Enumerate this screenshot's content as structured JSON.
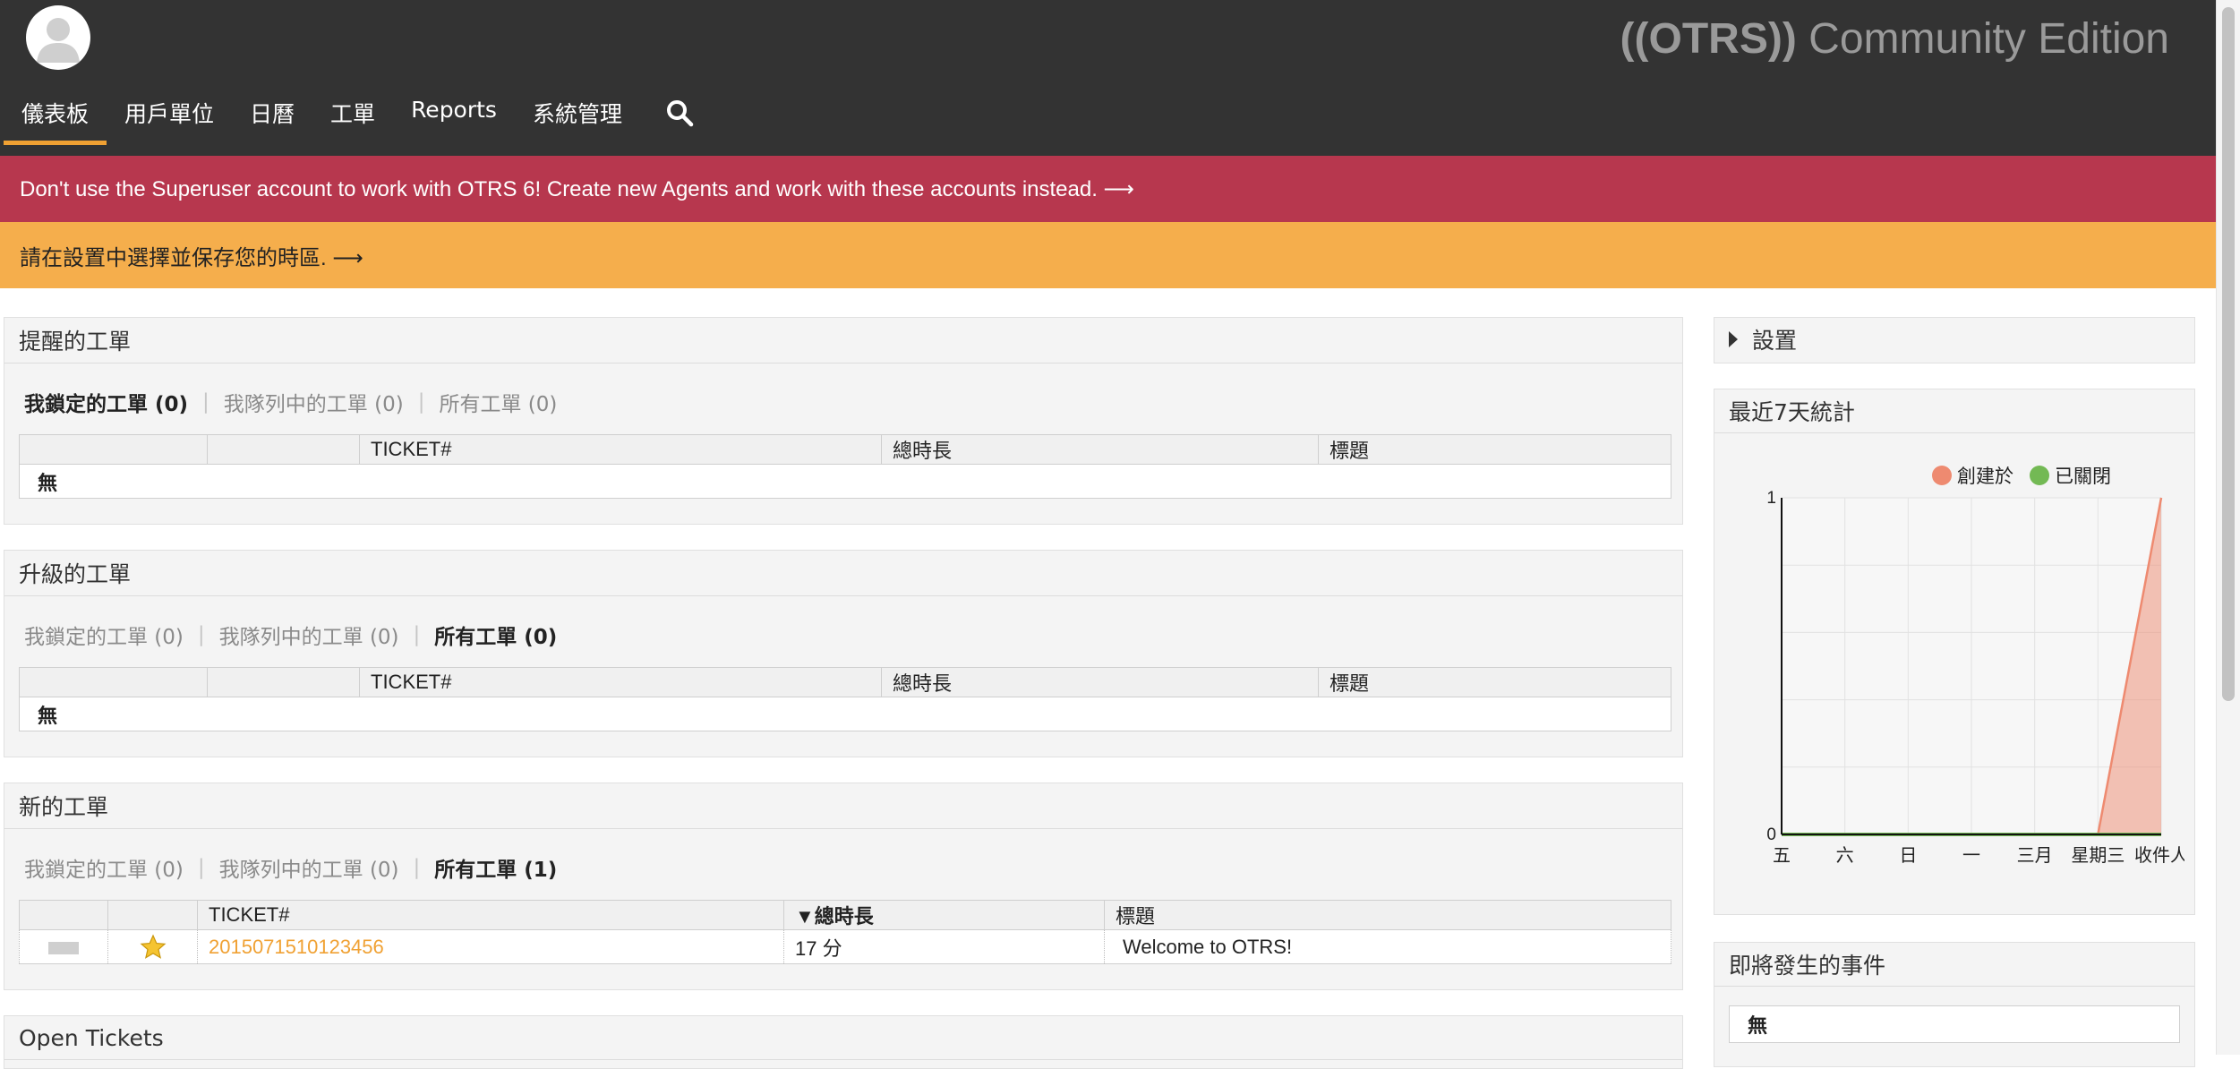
{
  "brand": {
    "logo": "((OTRS))",
    "edition": "Community Edition"
  },
  "nav": {
    "items": [
      {
        "label": "儀表板",
        "active": true
      },
      {
        "label": "用戶單位"
      },
      {
        "label": "日曆"
      },
      {
        "label": "工單"
      },
      {
        "label": "Reports"
      },
      {
        "label": "系統管理"
      }
    ],
    "search_icon": "search-icon",
    "accent": "#f0a133"
  },
  "notices": {
    "superuser": "Don't use the Superuser account to work with OTRS 6! Create new Agents and work with these accounts instead. ⟶",
    "timezone": "請在設置中選擇並保存您的時區. ⟶"
  },
  "widgets": {
    "reminder": {
      "title": "提醒的工單",
      "filters": [
        "我鎖定的工單 (0)",
        "我隊列中的工單 (0)",
        "所有工單 (0)"
      ],
      "selected_filter": 0,
      "columns": [
        "",
        "",
        "TICKET#",
        "總時長",
        "標題"
      ],
      "empty_text": "無"
    },
    "escalated": {
      "title": "升級的工單",
      "filters": [
        "我鎖定的工單 (0)",
        "我隊列中的工單 (0)",
        "所有工單 (0)"
      ],
      "selected_filter": 2,
      "columns": [
        "",
        "",
        "TICKET#",
        "總時長",
        "標題"
      ],
      "empty_text": "無"
    },
    "new": {
      "title": "新的工單",
      "filters": [
        "我鎖定的工單 (0)",
        "我隊列中的工單 (0)",
        "所有工單 (1)"
      ],
      "selected_filter": 2,
      "columns": [
        "",
        "",
        "TICKET#",
        "▼總時長",
        "標題"
      ],
      "rows": [
        {
          "ticket": "2015071510123456",
          "age": "17 分",
          "title": "Welcome to OTRS!"
        }
      ]
    },
    "open": {
      "title": "Open Tickets"
    }
  },
  "sidebar": {
    "settings": "設置",
    "stats_title": "最近7天統計",
    "upcoming_title": "即將發生的事件",
    "upcoming_empty": "無"
  },
  "chart_data": {
    "type": "area",
    "categories": [
      "五",
      "六",
      "日",
      "一",
      "三月",
      "星期三",
      "收件人"
    ],
    "series": [
      {
        "name": "創建於",
        "color": "#ee8a70",
        "values": [
          0,
          0,
          0,
          0,
          0,
          0,
          1
        ]
      },
      {
        "name": "已關閉",
        "color": "#73b954",
        "values": [
          0,
          0,
          0,
          0,
          0,
          0,
          0
        ]
      }
    ],
    "ylim": [
      0,
      1
    ],
    "y_ticks": [
      "0",
      "1"
    ],
    "grid": true,
    "legend": "top-right"
  }
}
